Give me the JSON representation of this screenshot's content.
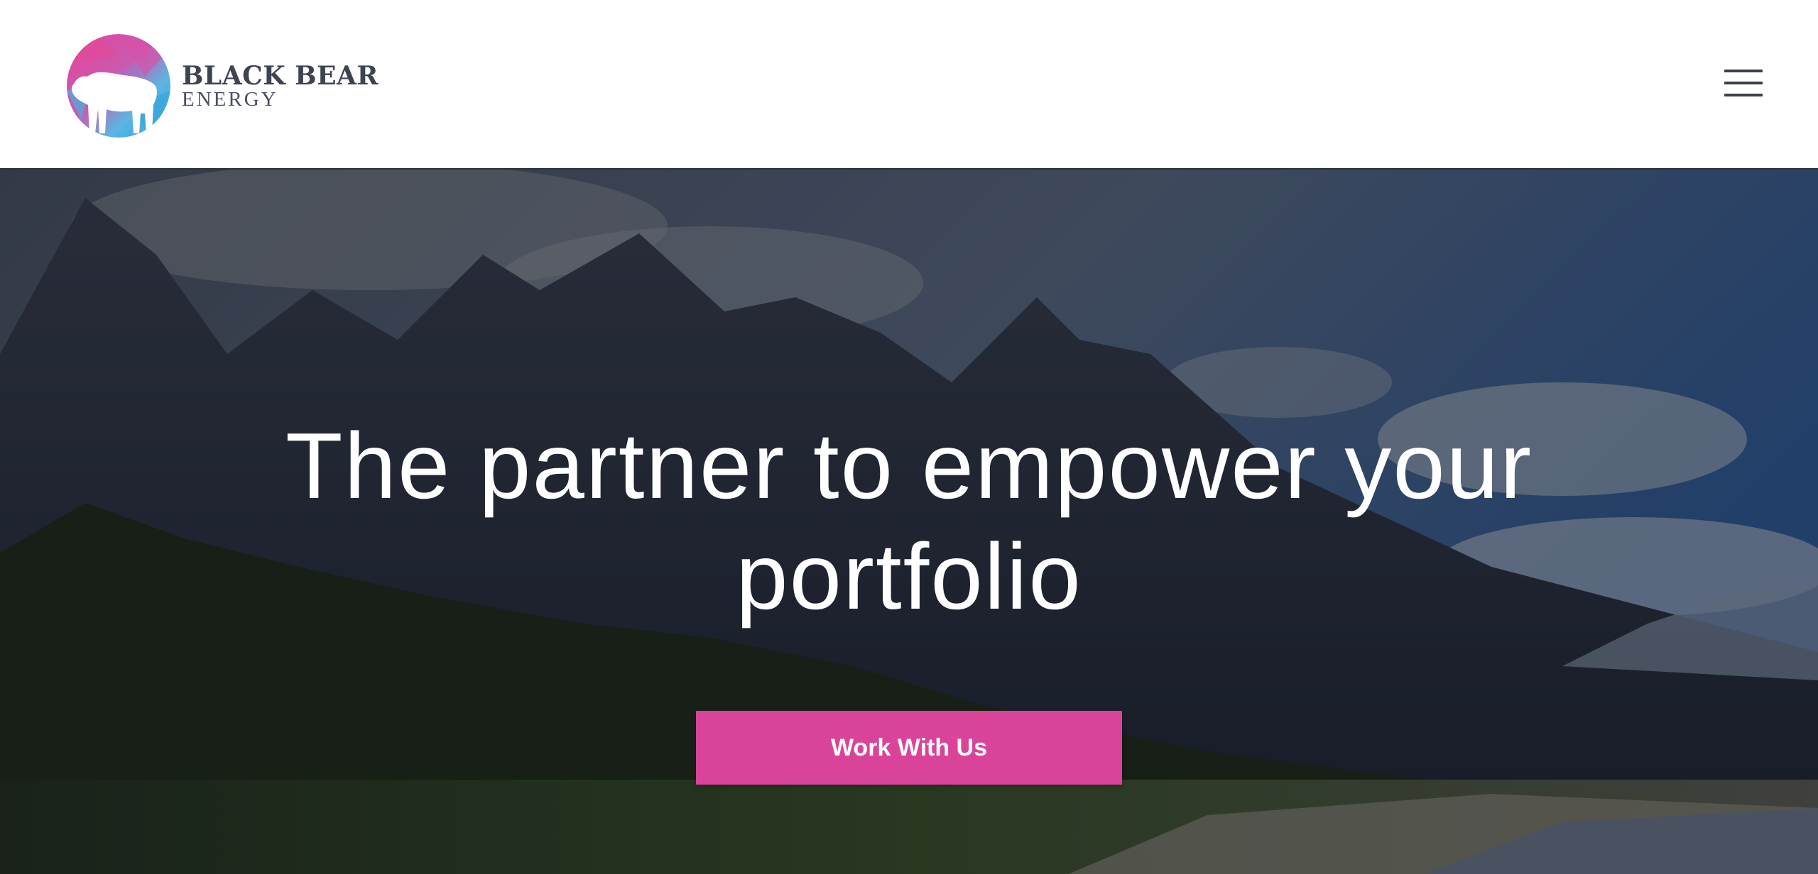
{
  "brand": {
    "name": "BLACK BEAR",
    "sub": "ENERGY",
    "logo_icon": "bear-globe-icon",
    "colors": {
      "pink": "#d9449a",
      "blue": "#3ab0de",
      "text": "#3d4353"
    }
  },
  "header": {
    "menu_icon": "hamburger-menu-icon"
  },
  "hero": {
    "headline": "The partner to empower your portfolio",
    "cta_label": "Work With Us",
    "cta_color": "#d9449a",
    "background": "mountain-forest-solar-photo"
  }
}
